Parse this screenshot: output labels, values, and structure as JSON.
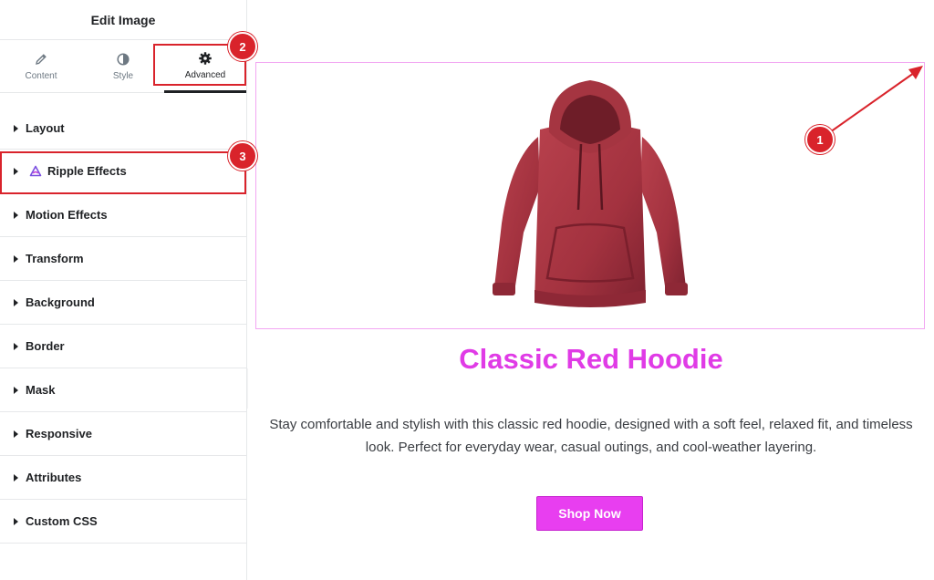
{
  "panel": {
    "title": "Edit Image",
    "tabs": [
      {
        "label": "Content",
        "icon": "pencil-icon"
      },
      {
        "label": "Style",
        "icon": "contrast-icon"
      },
      {
        "label": "Advanced",
        "icon": "gear-icon",
        "active": true
      }
    ],
    "sections": [
      {
        "label": "Layout"
      },
      {
        "label": "Ripple Effects",
        "icon": "ripple-logo-icon"
      },
      {
        "label": "Motion Effects"
      },
      {
        "label": "Transform"
      },
      {
        "label": "Background"
      },
      {
        "label": "Border"
      },
      {
        "label": "Mask"
      },
      {
        "label": "Responsive"
      },
      {
        "label": "Attributes"
      },
      {
        "label": "Custom CSS"
      }
    ]
  },
  "canvas": {
    "product_title": "Classic Red Hoodie",
    "product_description": "Stay comfortable and stylish with this classic red hoodie, designed with a soft feel, relaxed fit, and timeless look. Perfect for everyday wear, casual outings, and cool-weather layering.",
    "button_label": "Shop Now",
    "image_alt": "hoodie-image"
  },
  "annotations": {
    "badges": [
      "1",
      "2",
      "3"
    ]
  },
  "colors": {
    "accent_pink": "#e03be6",
    "button_pink": "#e83ef0",
    "annotation_red": "#d9232b",
    "image_border": "#f2a6f2",
    "hoodie": "#a3323f"
  }
}
